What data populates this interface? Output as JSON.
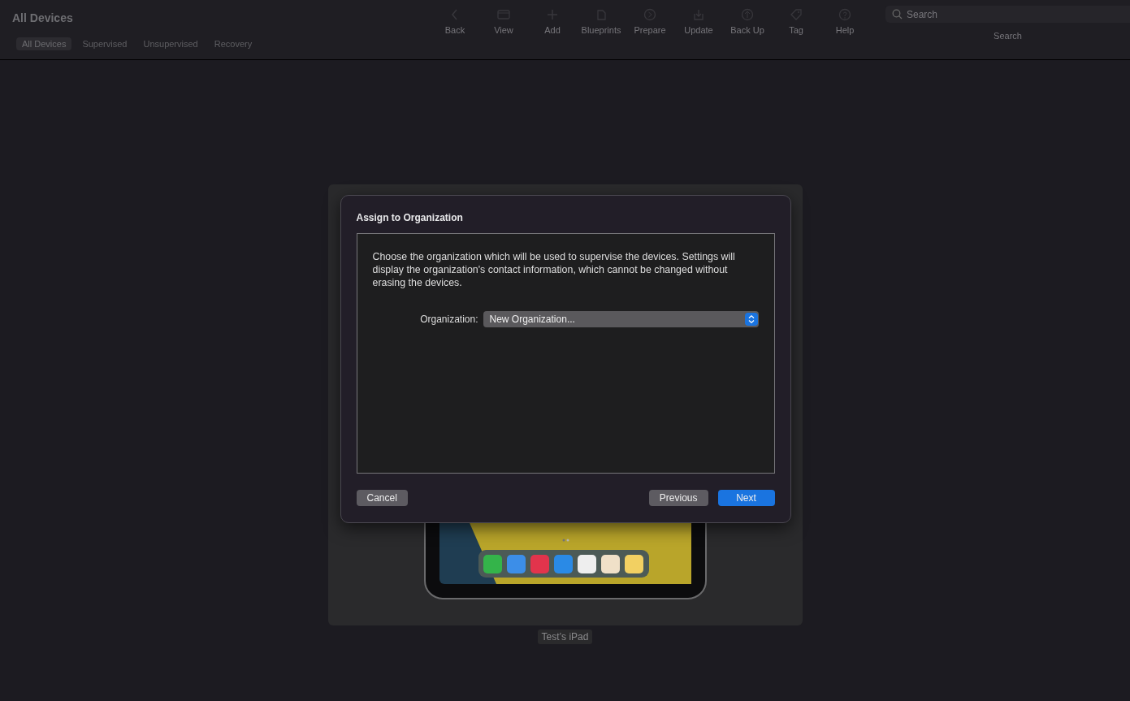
{
  "window": {
    "title": "All Devices"
  },
  "tabs": [
    {
      "label": "All Devices",
      "selected": true
    },
    {
      "label": "Supervised",
      "selected": false
    },
    {
      "label": "Unsupervised",
      "selected": false
    },
    {
      "label": "Recovery",
      "selected": false
    }
  ],
  "toolbar": [
    {
      "kind": "back",
      "label": "Back"
    },
    {
      "kind": "view",
      "label": "View"
    },
    {
      "kind": "add",
      "label": "Add"
    },
    {
      "kind": "blueprints",
      "label": "Blueprints"
    },
    {
      "kind": "prepare",
      "label": "Prepare"
    },
    {
      "kind": "update",
      "label": "Update"
    },
    {
      "kind": "backup",
      "label": "Back Up"
    },
    {
      "kind": "tag",
      "label": "Tag"
    },
    {
      "kind": "help",
      "label": "Help"
    }
  ],
  "search": {
    "placeholder": "Search",
    "label": "Search"
  },
  "device": {
    "name": "Test’s iPad"
  },
  "dialog": {
    "title": "Assign to Organization",
    "description": "Choose the organization which will be used to supervise the devices. Settings will display the organization's contact information, which cannot be changed without erasing the devices.",
    "field_label": "Organization:",
    "field_value": "New Organization...",
    "buttons": {
      "cancel": "Cancel",
      "previous": "Previous",
      "next": "Next"
    }
  }
}
